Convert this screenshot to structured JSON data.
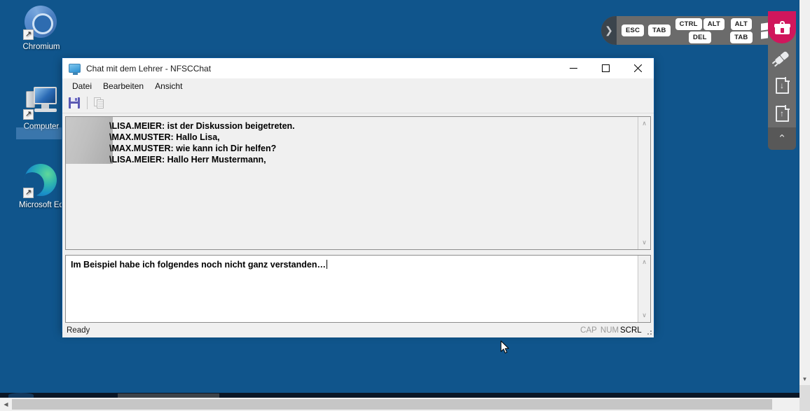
{
  "desktop": {
    "background_color": "#10558c",
    "icons": [
      {
        "label": "Chromium",
        "icon": "chromium-icon"
      },
      {
        "label": "Computer",
        "icon": "computer-icon"
      },
      {
        "label": "Microsoft Ed",
        "icon": "microsoft-edge-icon"
      }
    ]
  },
  "window": {
    "title": "Chat mit dem Lehrer - NFSCChat",
    "icon": "chat-monitor-icon",
    "controls": {
      "minimize": "─",
      "maximize": "□",
      "close": "✕"
    },
    "menu": [
      {
        "label": "Datei"
      },
      {
        "label": "Bearbeiten"
      },
      {
        "label": "Ansicht"
      }
    ],
    "toolbar": [
      {
        "name": "save-button",
        "icon": "floppy-disk-icon",
        "enabled": true
      },
      {
        "name": "copy-button",
        "icon": "copy-icon",
        "enabled": false
      }
    ],
    "history": {
      "messages": [
        "\\LISA.MEIER: ist der Diskussion beigetreten.",
        "\\MAX.MUSTER: Hallo Lisa,",
        "\\MAX.MUSTER: wie kann ich Dir helfen?",
        "\\LISA.MEIER: Hallo Herr Mustermann,"
      ]
    },
    "input": {
      "value": "Im Beispiel habe ich folgendes noch nicht ganz verstanden…",
      "placeholder": ""
    },
    "statusbar": {
      "status": "Ready",
      "indicators": [
        {
          "label": "CAP",
          "active": false
        },
        {
          "label": "NUM",
          "active": false
        },
        {
          "label": "SCRL",
          "active": true
        }
      ]
    },
    "scrollbars": {
      "up_arrow": "∧",
      "down_arrow": "∨"
    }
  },
  "virtual_keys": {
    "handle": "❯",
    "keys": [
      {
        "label": "ESC"
      },
      {
        "label": "TAB"
      }
    ],
    "ctrl_alt_del": {
      "top": [
        "CTRL",
        "ALT"
      ],
      "bottom": [
        "DEL"
      ]
    },
    "alt_tab": {
      "top": [
        "ALT"
      ],
      "bottom": [
        "TAB"
      ]
    },
    "windows_key": "windows-logo-icon"
  },
  "rail": {
    "buttons": [
      {
        "name": "toolbox-button",
        "icon": "toolbox-icon",
        "color": "#d0165c"
      },
      {
        "name": "connection-button",
        "icon": "plug-icon"
      },
      {
        "name": "download-file-button",
        "icon": "file-download-icon",
        "arrow": "↓"
      },
      {
        "name": "upload-file-button",
        "icon": "file-upload-icon",
        "arrow": "↑"
      },
      {
        "name": "collapse-button",
        "icon": "chevron-up-icon",
        "arrow": "⌃"
      }
    ]
  },
  "viewer": {
    "h_left_arrow": "◀",
    "v_down_arrow": "▼"
  }
}
